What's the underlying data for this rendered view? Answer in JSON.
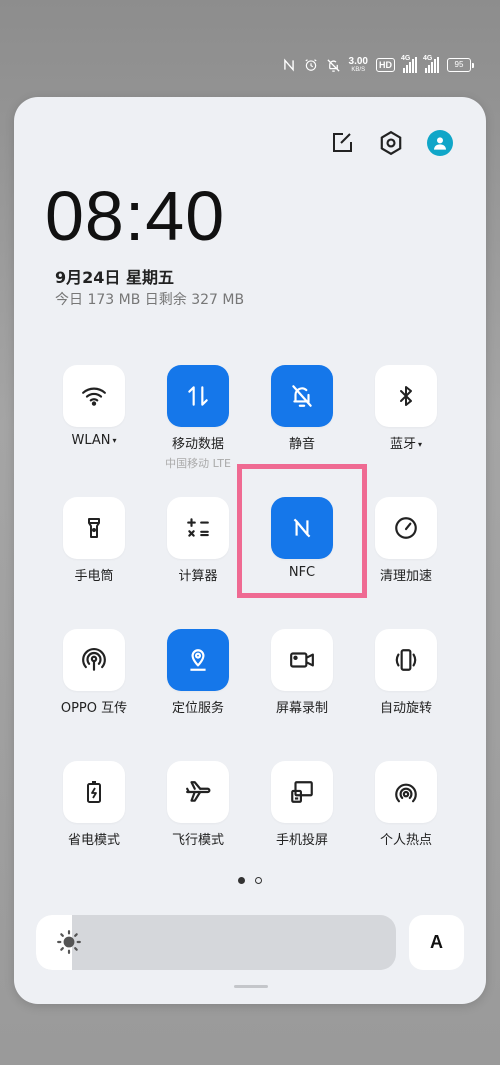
{
  "status_bar": {
    "net_speed_value": "3.00",
    "net_speed_unit": "KB/S",
    "hd_label": "HD",
    "sim1_tag": "4G",
    "sim2_tag": "4G",
    "battery": "95",
    "icons": [
      "nfc-icon",
      "alarm-icon",
      "mute-icon",
      "wifi-call-icon",
      "signal-icon",
      "battery-icon"
    ]
  },
  "header": {
    "time": "08:40",
    "date": "9月24日  星期五",
    "data_usage": "今日 173 MB 日剩余 327 MB"
  },
  "tiles": [
    {
      "id": "wlan",
      "label": "WLAN",
      "caret": "▾",
      "sub": "",
      "on": false,
      "icon": "wifi-icon"
    },
    {
      "id": "mobile-data",
      "label": "移动数据",
      "caret": "",
      "sub": "中国移动 LTE",
      "on": true,
      "icon": "mobile-data-icon"
    },
    {
      "id": "mute",
      "label": "静音",
      "caret": "",
      "sub": "",
      "on": true,
      "icon": "bell-off-icon"
    },
    {
      "id": "bluetooth",
      "label": "蓝牙",
      "caret": "▾",
      "sub": "",
      "on": false,
      "icon": "bluetooth-icon"
    },
    {
      "id": "flashlight",
      "label": "手电筒",
      "caret": "",
      "sub": "",
      "on": false,
      "icon": "flashlight-icon"
    },
    {
      "id": "calculator",
      "label": "计算器",
      "caret": "",
      "sub": "",
      "on": false,
      "icon": "calculator-icon"
    },
    {
      "id": "nfc",
      "label": "NFC",
      "caret": "",
      "sub": "",
      "on": true,
      "icon": "nfc-icon"
    },
    {
      "id": "cleanup",
      "label": "清理加速",
      "caret": "",
      "sub": "",
      "on": false,
      "icon": "speedometer-icon"
    },
    {
      "id": "oppo-share",
      "label": "OPPO 互传",
      "caret": "",
      "sub": "",
      "on": false,
      "icon": "broadcast-icon"
    },
    {
      "id": "location",
      "label": "定位服务",
      "caret": "",
      "sub": "",
      "on": true,
      "icon": "location-icon"
    },
    {
      "id": "screen-record",
      "label": "屏幕录制",
      "caret": "",
      "sub": "",
      "on": false,
      "icon": "video-icon"
    },
    {
      "id": "auto-rotate",
      "label": "自动旋转",
      "caret": "",
      "sub": "",
      "on": false,
      "icon": "rotate-icon"
    },
    {
      "id": "power-saving",
      "label": "省电模式",
      "caret": "",
      "sub": "",
      "on": false,
      "icon": "battery-saver-icon"
    },
    {
      "id": "airplane",
      "label": "飞行模式",
      "caret": "",
      "sub": "",
      "on": false,
      "icon": "airplane-icon"
    },
    {
      "id": "screen-cast",
      "label": "手机投屏",
      "caret": "",
      "sub": "",
      "on": false,
      "icon": "cast-icon"
    },
    {
      "id": "hotspot",
      "label": "个人热点",
      "caret": "",
      "sub": "",
      "on": false,
      "icon": "hotspot-icon"
    }
  ],
  "brightness": {
    "level": 0.0,
    "auto_label": "A"
  },
  "pages": {
    "total": 2,
    "current": 1
  },
  "colors": {
    "accent": "#1577ea",
    "highlight": "#ef6a92",
    "avatar": "#10a6c8"
  }
}
